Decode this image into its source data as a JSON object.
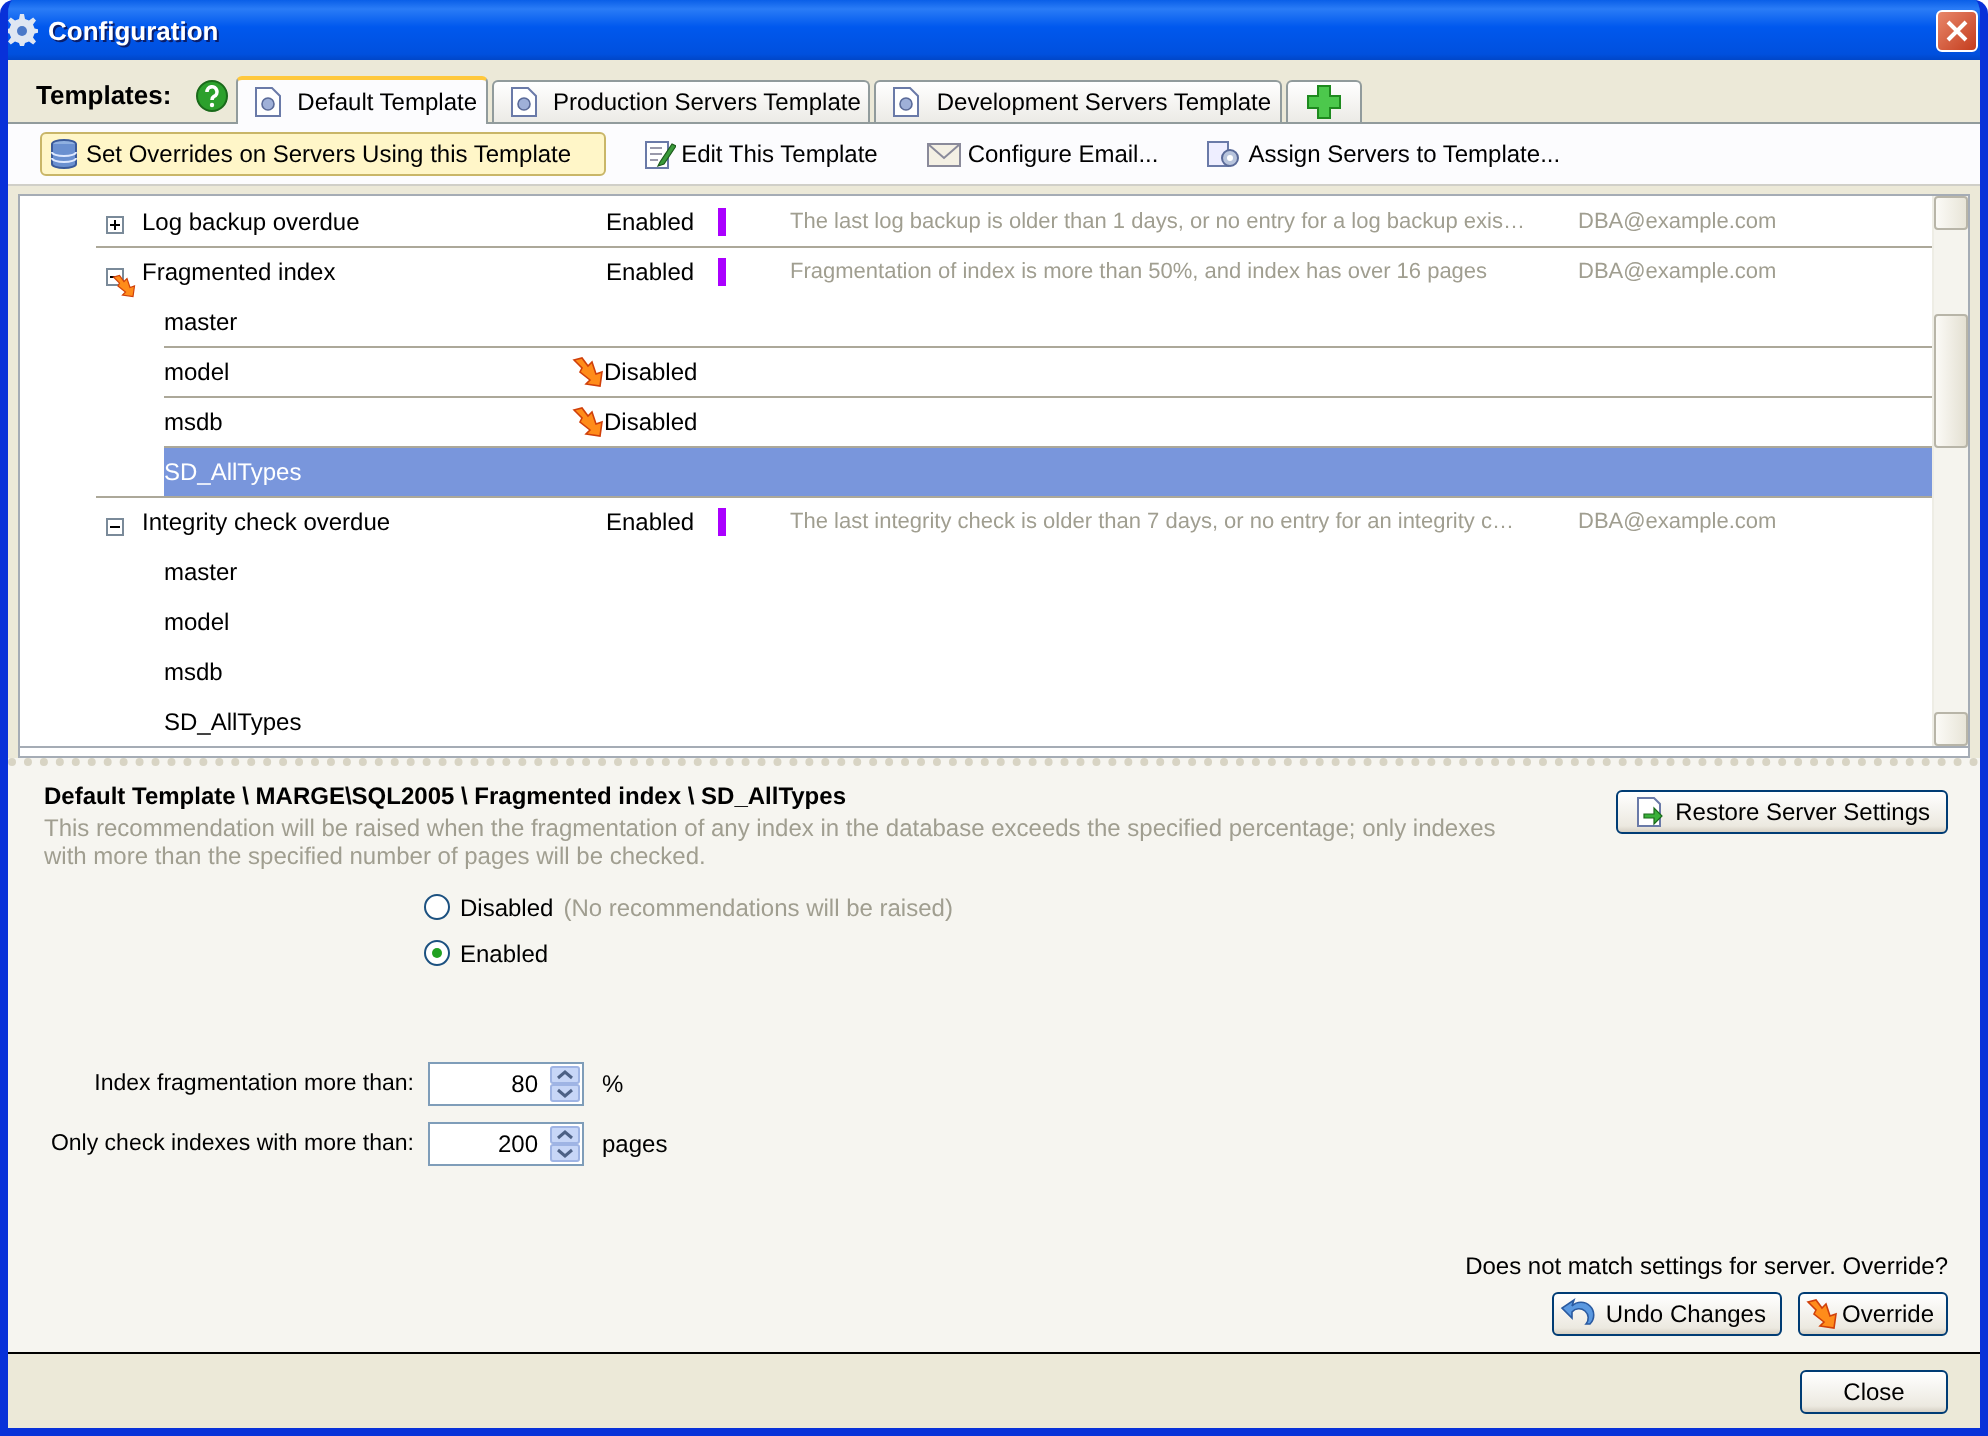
{
  "window": {
    "title": "Configuration"
  },
  "templates_label": "Templates:",
  "tabs": [
    {
      "label": "Default Template",
      "selected": true
    },
    {
      "label": "Production Servers Template",
      "selected": false
    },
    {
      "label": "Development Servers Template",
      "selected": false
    }
  ],
  "toolbar": [
    {
      "label": "Set Overrides on Servers Using this Template",
      "kind": "servers",
      "pressed": true
    },
    {
      "label": "Edit This Template",
      "kind": "edit",
      "pressed": false
    },
    {
      "label": "Configure Email...",
      "kind": "email",
      "pressed": false
    },
    {
      "label": "Assign Servers to Template...",
      "kind": "assign",
      "pressed": false
    }
  ],
  "tree": [
    {
      "name": "Log backup overdue",
      "expanded": false,
      "overridden": false,
      "status": "Enabled",
      "color": "#aa00ff",
      "description": "The last log backup is older than 1 days, or no entry for a log backup exis…",
      "email": "DBA@example.com"
    },
    {
      "name": "Fragmented index",
      "expanded": true,
      "overridden": true,
      "status": "Enabled",
      "color": "#aa00ff",
      "description": "Fragmentation of index is more than 50%, and index has over 16 pages",
      "email": "DBA@example.com",
      "children": [
        {
          "name": "master",
          "overridden": false,
          "selected": false
        },
        {
          "name": "model",
          "overridden": true,
          "status": "Disabled",
          "selected": false
        },
        {
          "name": "msdb",
          "overridden": true,
          "status": "Disabled",
          "selected": false
        },
        {
          "name": "SD_AllTypes",
          "overridden": false,
          "selected": true
        }
      ]
    },
    {
      "name": "Integrity check overdue",
      "expanded": true,
      "overridden": false,
      "status": "Enabled",
      "color": "#aa00ff",
      "description": "The last integrity check is older than 7 days, or no entry for an integrity c…",
      "email": "DBA@example.com",
      "children": [
        {
          "name": "master",
          "overridden": false,
          "selected": false
        },
        {
          "name": "model",
          "overridden": false,
          "selected": false
        },
        {
          "name": "msdb",
          "overridden": false,
          "selected": false
        },
        {
          "name": "SD_AllTypes",
          "overridden": false,
          "selected": false
        }
      ]
    }
  ],
  "detail": {
    "path": "Default Template \\ MARGE\\SQL2005 \\ Fragmented index \\ SD_AllTypes",
    "description": "This recommendation will be raised when the fragmentation of any index in the database exceeds the specified percentage; only indexes with more than the specified number of pages will be checked.",
    "restore_button": "Restore Server Settings",
    "options": [
      {
        "label": "Disabled",
        "note": "(No recommendations will be raised)",
        "selected": false
      },
      {
        "label": "Enabled",
        "selected": true
      }
    ],
    "fields": [
      {
        "label": "Index fragmentation more than:",
        "value": "80",
        "unit": "%"
      },
      {
        "label": "Only check indexes with more than:",
        "value": "200",
        "unit": "pages"
      }
    ],
    "mismatch": "Does not match settings for server. Override?",
    "undo_button": "Undo Changes",
    "override_button": "Override"
  },
  "close_button": "Close"
}
